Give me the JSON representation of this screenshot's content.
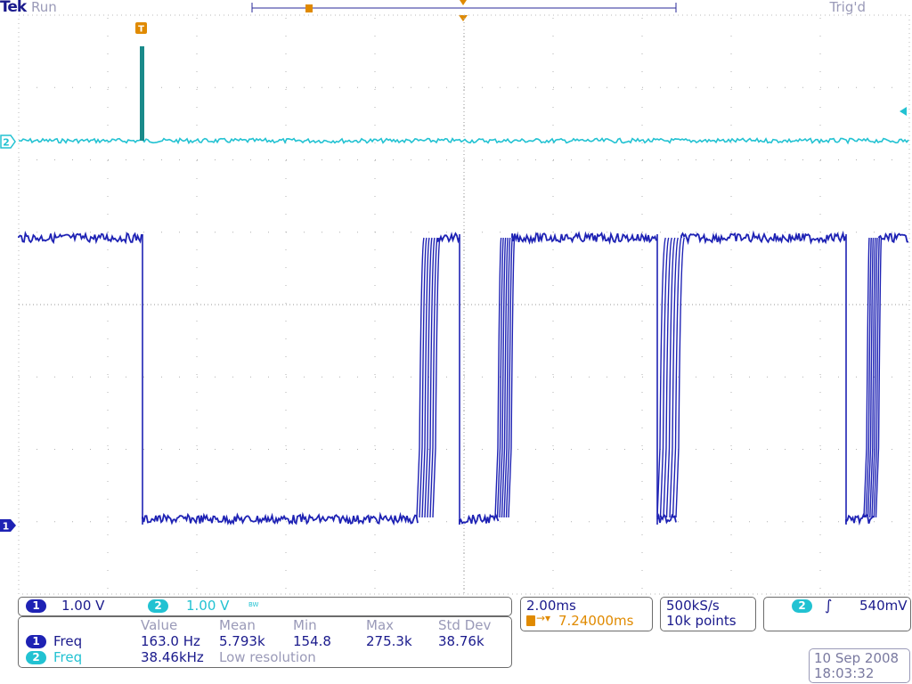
{
  "header": {
    "brand": "Tek",
    "run_state": "Run",
    "trigger_status": "Trig'd"
  },
  "markers": {
    "trigger_marker": "T",
    "ch1_marker": "1",
    "ch2_marker": "2"
  },
  "channels": {
    "ch1": {
      "label": "1",
      "scale": "1.00 V",
      "color": "#1e22b4"
    },
    "ch2": {
      "label": "2",
      "scale": "1.00 V",
      "bandwidth_mark": "BW",
      "color": "#22c2d2"
    }
  },
  "timebase": {
    "scale": "2.00ms",
    "trigger_position": "7.24000ms",
    "sample_rate": "500kS/s",
    "record_length": "10k points"
  },
  "trigger": {
    "source": "2",
    "slope_icon": "rising-edge-icon",
    "level": "540mV"
  },
  "measurements": {
    "headers": [
      "Value",
      "Mean",
      "Min",
      "Max",
      "Std Dev"
    ],
    "rows": [
      {
        "channel": "1",
        "name": "Freq",
        "value": "163.0 Hz",
        "mean": "5.793k",
        "min": "154.8",
        "max": "275.3k",
        "std_dev": "38.76k"
      },
      {
        "channel": "2",
        "name": "Freq",
        "value": "38.46kHz",
        "note": "Low resolution"
      }
    ]
  },
  "datetime": {
    "date": "10 Sep  2008",
    "time": "18:03:32"
  }
}
